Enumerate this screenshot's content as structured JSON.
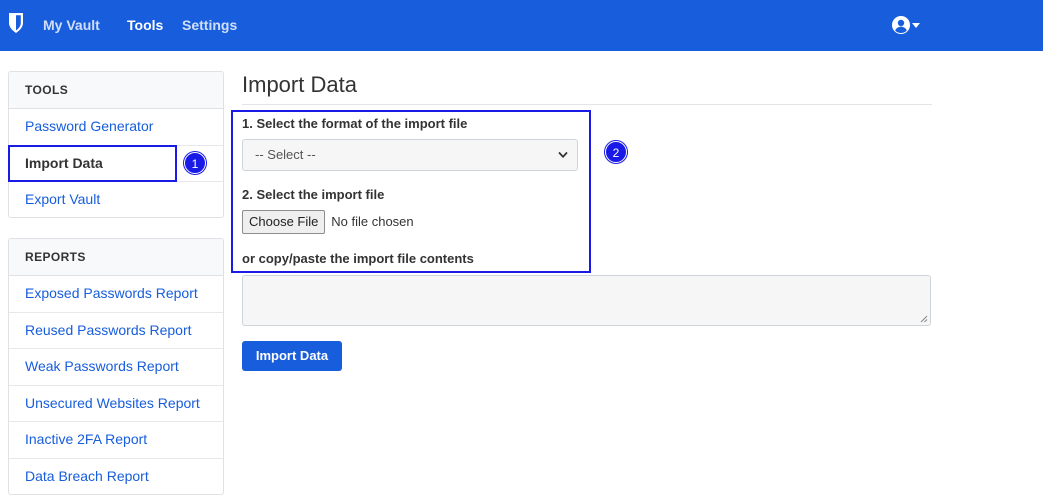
{
  "nav": {
    "logo_icon": "bitwarden-shield-icon",
    "links": [
      {
        "label": "My Vault",
        "active": false
      },
      {
        "label": "Tools",
        "active": true
      },
      {
        "label": "Settings",
        "active": false
      }
    ],
    "account_icon": "user-circle-icon"
  },
  "sidebar": {
    "tools": {
      "header": "TOOLS",
      "items": [
        {
          "label": "Password Generator",
          "active": false
        },
        {
          "label": "Import Data",
          "active": true
        },
        {
          "label": "Export Vault",
          "active": false
        }
      ]
    },
    "reports": {
      "header": "REPORTS",
      "items": [
        {
          "label": "Exposed Passwords Report"
        },
        {
          "label": "Reused Passwords Report"
        },
        {
          "label": "Weak Passwords Report"
        },
        {
          "label": "Unsecured Websites Report"
        },
        {
          "label": "Inactive 2FA Report"
        },
        {
          "label": "Data Breach Report"
        }
      ]
    }
  },
  "main": {
    "title": "Import Data",
    "format_label": "1. Select the format of the import file",
    "format_select": {
      "selected": "-- Select --"
    },
    "file_label": "2. Select the import file",
    "file_button": "Choose File",
    "file_status": "No file chosen",
    "paste_label": "or copy/paste the import file contents",
    "textarea_value": "",
    "submit_label": "Import Data"
  },
  "annotations": {
    "marker_1": "1",
    "marker_2": "2",
    "color": "#1a1ae6"
  },
  "colors": {
    "brand": "#175ddc",
    "link": "#175ddc",
    "text": "#333333"
  }
}
